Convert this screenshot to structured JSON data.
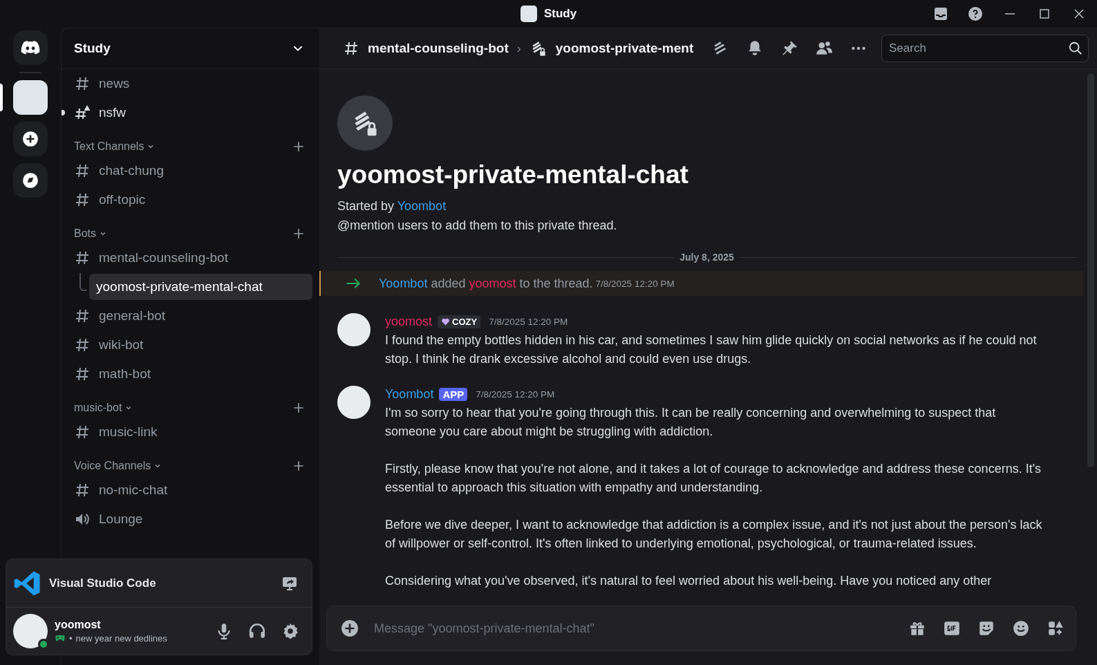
{
  "window": {
    "title": "Study"
  },
  "server_rail": [
    {
      "kind": "home",
      "selected": false
    },
    {
      "kind": "server",
      "selected": true
    },
    {
      "kind": "add",
      "selected": false
    },
    {
      "kind": "discover",
      "selected": false
    }
  ],
  "server": {
    "name": "Study"
  },
  "channels": [
    {
      "kind": "text",
      "label": "news",
      "unread": false,
      "selected": false
    },
    {
      "kind": "nsfw",
      "label": "nsfw",
      "unread": true,
      "selected": false
    },
    {
      "kind": "category",
      "label": "Text Channels",
      "children": [
        {
          "kind": "text",
          "label": "chat-chung",
          "unread": false,
          "selected": false
        },
        {
          "kind": "text",
          "label": "off-topic",
          "unread": false,
          "selected": false
        }
      ]
    },
    {
      "kind": "category",
      "label": "Bots",
      "children": [
        {
          "kind": "text",
          "label": "mental-counseling-bot",
          "unread": false,
          "selected": false,
          "children": [
            {
              "kind": "thread",
              "label": "yoomost-private-mental-chat",
              "unread": false,
              "selected": true
            }
          ]
        },
        {
          "kind": "text",
          "label": "general-bot",
          "unread": false,
          "selected": false
        },
        {
          "kind": "text",
          "label": "wiki-bot",
          "unread": false,
          "selected": false
        },
        {
          "kind": "text",
          "label": "math-bot",
          "unread": false,
          "selected": false
        }
      ]
    },
    {
      "kind": "category",
      "label": "music-bot",
      "children": [
        {
          "kind": "text",
          "label": "music-link",
          "unread": false,
          "selected": false
        }
      ]
    },
    {
      "kind": "category",
      "label": "Voice Channels",
      "children": [
        {
          "kind": "text",
          "label": "no-mic-chat",
          "unread": false,
          "selected": false
        },
        {
          "kind": "voice",
          "label": "Lounge",
          "unread": false,
          "selected": false
        }
      ]
    }
  ],
  "activity": {
    "name": "Visual Studio Code"
  },
  "user": {
    "name": "yoomost",
    "separator": "•",
    "status_text": "new year new dedlines",
    "online": true
  },
  "header": {
    "channel": "mental-counseling-bot",
    "separator": "›",
    "thread": "yoomost-private-ment",
    "search_placeholder": "Search"
  },
  "thread_intro": {
    "title": "yoomost-private-mental-chat",
    "started_by": "Started by",
    "starter": "Yoombot",
    "hint": "@mention users to add them to this private thread."
  },
  "date_divider": "July 8, 2025",
  "messages": [
    {
      "kind": "system",
      "actor": {
        "name": "Yoombot",
        "color": "#3d9fe5"
      },
      "action": "added",
      "target": {
        "name": "yoomost",
        "color": "#e5285f"
      },
      "rest": "to the thread.",
      "time": "7/8/2025 12:20 PM",
      "highlighted": true
    },
    {
      "kind": "user",
      "author": "yoomost",
      "color": "#e5285f",
      "tag": {
        "kind": "guild",
        "label": "COZY"
      },
      "time": "7/8/2025 12:20 PM",
      "paragraphs": [
        "I found the empty bottles hidden in his car, and sometimes I saw him glide quickly on social networks as if he could not stop. I think he drank excessive alcohol and could even use drugs."
      ]
    },
    {
      "kind": "user",
      "author": "Yoombot",
      "color": "#3d9fe5",
      "tag": {
        "kind": "app",
        "label": "APP"
      },
      "time": "7/8/2025 12:20 PM",
      "paragraphs": [
        "I'm so sorry to hear that you're going through this. It can be really concerning and overwhelming to suspect that someone you care about might be struggling with addiction.",
        "Firstly, please know that you're not alone, and it takes a lot of courage to acknowledge and address these concerns. It's essential to approach this situation with empathy and understanding.",
        "Before we dive deeper, I want to acknowledge that addiction is a complex issue, and it's not just about the person's lack of willpower or self-control. It's often linked to underlying emotional, psychological, or trauma-related issues.",
        "Considering what you've observed, it's natural to feel worried about his well-being. Have you noticed any other"
      ]
    }
  ],
  "composer": {
    "placeholder": "Message \"yoomost-private-mental-chat\""
  }
}
